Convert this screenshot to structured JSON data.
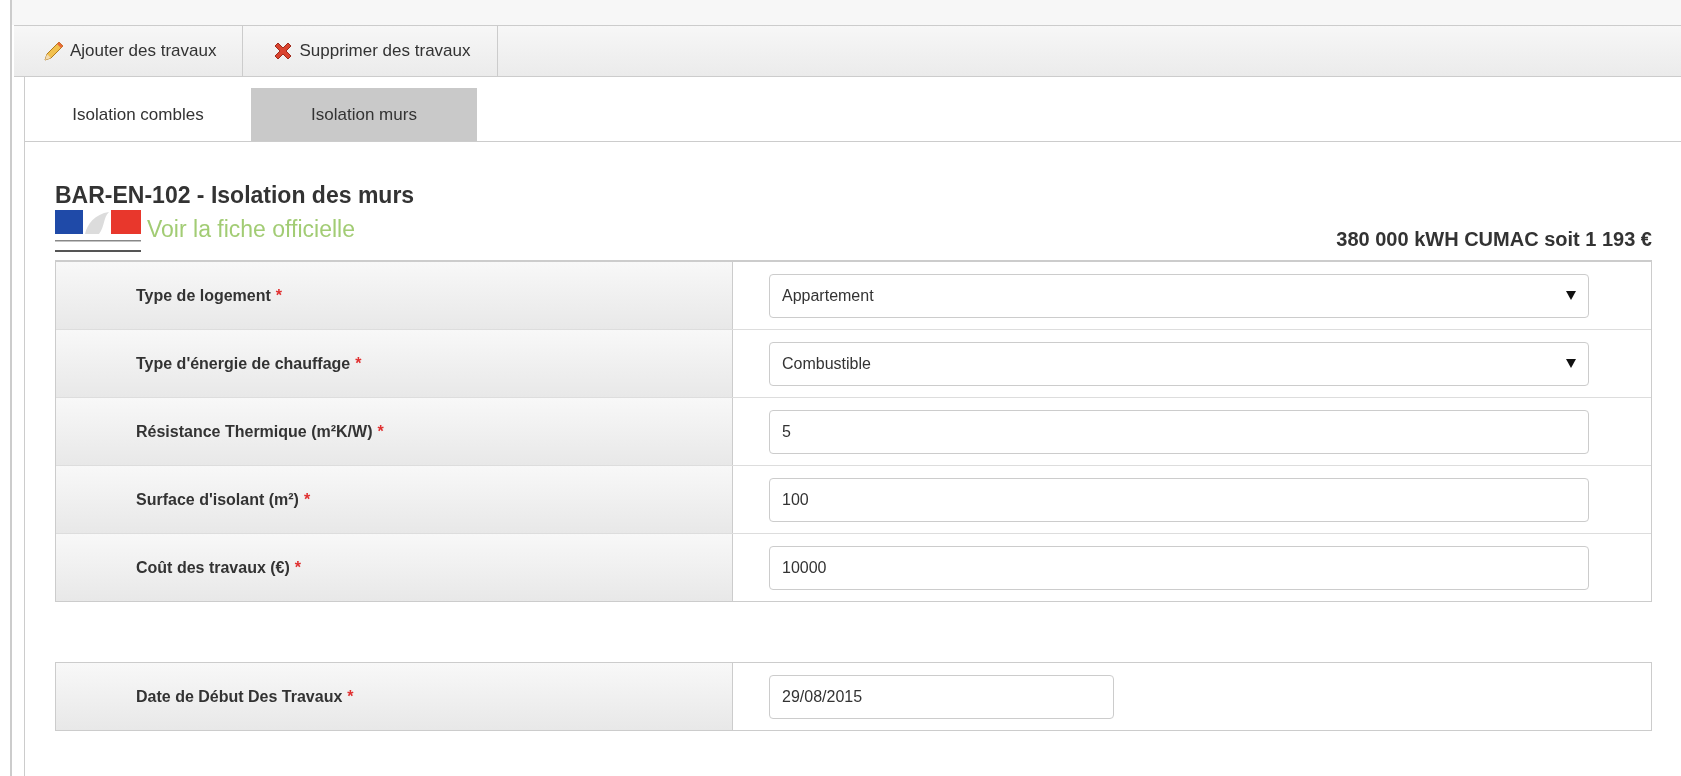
{
  "toolbar": {
    "buttons": [
      {
        "label": "Ajouter des travaux",
        "kind": "add"
      },
      {
        "label": "Supprimer des travaux",
        "kind": "delete"
      }
    ]
  },
  "tabs": [
    {
      "label": "Isolation combles",
      "selected": false
    },
    {
      "label": "Isolation murs",
      "selected": true
    }
  ],
  "section": {
    "title": "BAR-EN-102 - Isolation des murs",
    "link": "Voir la fiche officielle",
    "total": "380 000 kWH CUMAC soit 1 193 €"
  },
  "fields": [
    {
      "label": "Type de logement",
      "marker": "*",
      "kind": "select",
      "value": "Appartement"
    },
    {
      "label": "Type d'énergie de chauffage",
      "marker": "*",
      "kind": "select",
      "value": "Combustible"
    },
    {
      "label": "Résistance Thermique (m²K/W)",
      "marker": "*",
      "kind": "text",
      "value": "5"
    },
    {
      "label": "Surface d'isolant (m²)",
      "marker": "*",
      "kind": "text",
      "value": "100"
    },
    {
      "label": "Coût des travaux (€)",
      "marker": "*",
      "kind": "text",
      "value": "10000"
    }
  ],
  "date_fields": [
    {
      "label": "Date de Début Des Travaux",
      "marker": "*",
      "kind": "date",
      "value": "29/08/2015"
    }
  ]
}
